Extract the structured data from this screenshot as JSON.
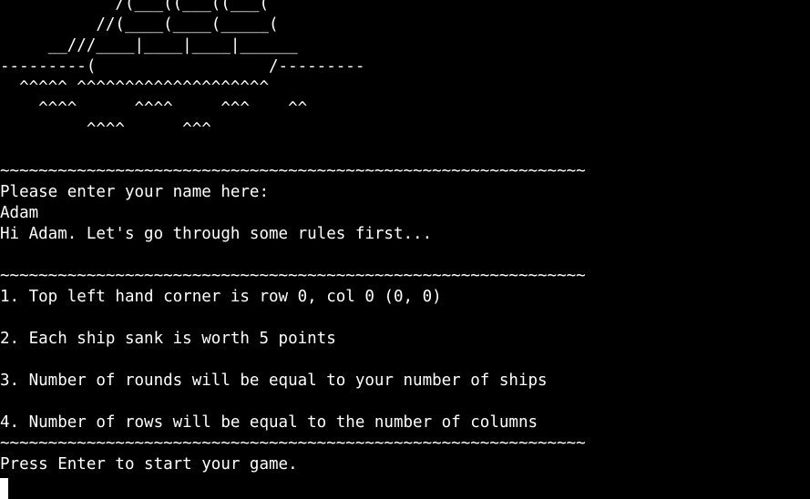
{
  "terminal": {
    "background": "#000000",
    "foreground": "#ffffff",
    "lines": [
      "            /(___((___((___(",
      "          //(____(____(_____(",
      "     __///____|____|____|______",
      "---------(                  /---------",
      "  ^^^^^ ^^^^^^^^^^^^^^^^^^^^",
      "    ^^^^      ^^^^     ^^^    ^^",
      "         ^^^^      ^^^",
      "",
      "~~~~~~~~~~~~~~~~~~~~~~~~~~~~~~~~~~~~~~~~~~~~~~~~~~~~~~~~~~~~~",
      "Please enter your name here:",
      "Adam",
      "Hi Adam. Let's go through some rules first...",
      "",
      "~~~~~~~~~~~~~~~~~~~~~~~~~~~~~~~~~~~~~~~~~~~~~~~~~~~~~~~~~~~~~",
      "1. Top left hand corner is row 0, col 0 (0, 0)",
      "",
      "2. Each ship sank is worth 5 points",
      "",
      "3. Number of rounds will be equal to your number of ships",
      "",
      "4. Number of rows will be equal to the number of columns",
      "~~~~~~~~~~~~~~~~~~~~~~~~~~~~~~~~~~~~~~~~~~~~~~~~~~~~~~~~~~~~~",
      "Press Enter to start your game."
    ]
  }
}
